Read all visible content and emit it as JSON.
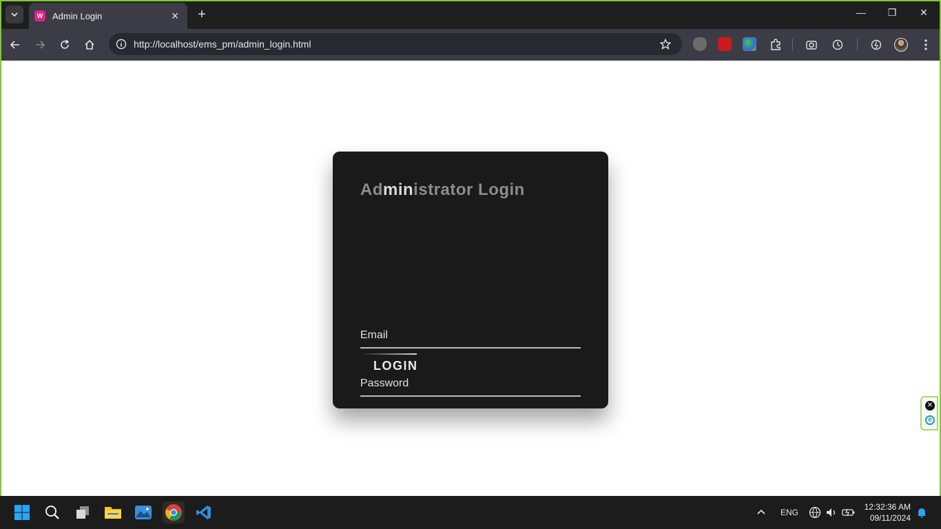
{
  "browser": {
    "tab_title": "Admin Login",
    "url": "http://localhost/ems_pm/admin_login.html",
    "accent": "#7ec832"
  },
  "page": {
    "title_prefix": "Ad",
    "title_highlight": "min",
    "title_suffix": "istrator Login",
    "email_label": "Email",
    "password_label": "Password",
    "login_label": "LOGIN"
  },
  "taskbar": {
    "language": "ENG",
    "time": "12:32:36 AM",
    "date": "09/11/2024"
  }
}
